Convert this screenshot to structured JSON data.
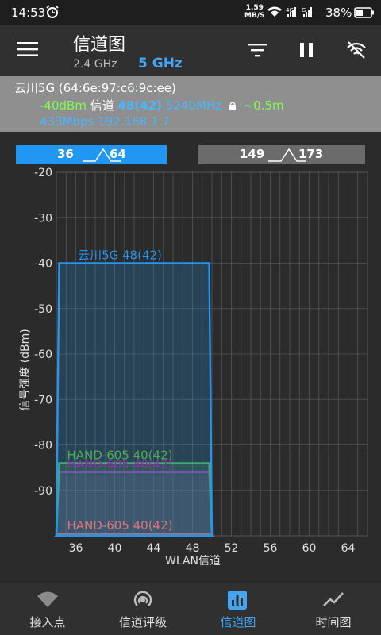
{
  "status": {
    "time": "14:53",
    "speed_value": "1.59",
    "speed_unit": "MB/S",
    "battery": "38%"
  },
  "app": {
    "title": "信道图",
    "band_24": "2.4 GHz",
    "band_5": "5 GHz"
  },
  "connection": {
    "ssid_line": "云川5G (64:6e:97:c6:9c:ee)",
    "rssi": "-40dBm",
    "channel_label": "信道",
    "channel": "48(42)",
    "frequency": "5240MHz",
    "distance": "~0.5m",
    "link": "433Mbps 192.168.1.7"
  },
  "ranges": [
    {
      "lo": "36",
      "hi": "64",
      "active": true
    },
    {
      "lo": "149",
      "hi": "173",
      "active": false
    }
  ],
  "chart_data": {
    "type": "area",
    "xlabel": "WLAN信道",
    "ylabel": "信号强度 (dBm)",
    "xlim": [
      34,
      66
    ],
    "ylim": [
      -100,
      -20
    ],
    "x_ticks": [
      36,
      40,
      44,
      48,
      52,
      56,
      60,
      64
    ],
    "y_ticks": [
      -20,
      -30,
      -40,
      -50,
      -60,
      -70,
      -80,
      -90
    ],
    "grid": true,
    "series": [
      {
        "name": "云川5G 48(42)",
        "center": 42,
        "width": 16,
        "value": -40,
        "color": "#2196f3"
      },
      {
        "name": "HAND-605 40(42)",
        "center": 42,
        "width": 16,
        "value": -84,
        "color": "#4caf50"
      },
      {
        "name": "HAND-605 40(42)",
        "center": 42,
        "width": 16,
        "value": -86,
        "color": "#9c27b0"
      },
      {
        "name": "HAND-605 40(42)",
        "center": 42,
        "width": 16,
        "value": -99.5,
        "color": "#e57373"
      }
    ]
  },
  "nav": [
    {
      "label": "接入点",
      "icon": "wifi-icon",
      "active": false
    },
    {
      "label": "信道评级",
      "icon": "radar-icon",
      "active": false
    },
    {
      "label": "信道图",
      "icon": "bar-chart-icon",
      "active": true
    },
    {
      "label": "时间图",
      "icon": "line-chart-icon",
      "active": false
    }
  ]
}
